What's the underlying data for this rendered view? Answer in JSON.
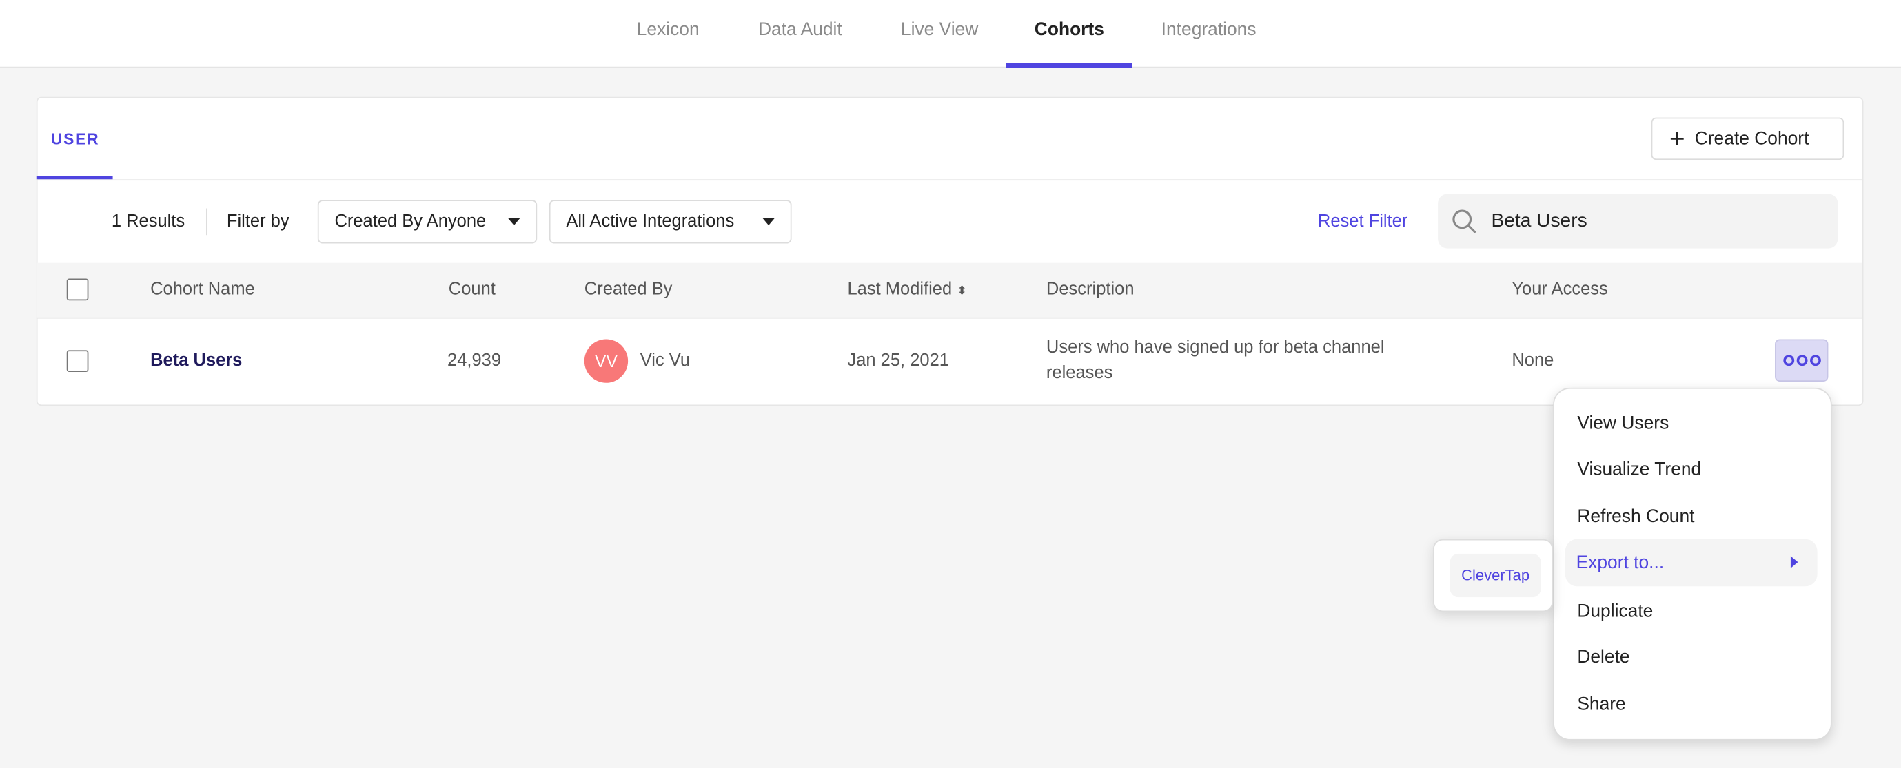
{
  "nav": {
    "tabs": [
      {
        "label": "Lexicon"
      },
      {
        "label": "Data Audit"
      },
      {
        "label": "Live View"
      },
      {
        "label": "Cohorts",
        "active": true
      },
      {
        "label": "Integrations"
      }
    ]
  },
  "section_tab": "USER",
  "create_button": "Create Cohort",
  "filters": {
    "results": "1 Results",
    "filter_by": "Filter by",
    "created_by": "Created By Anyone",
    "integrations": "All Active Integrations",
    "reset": "Reset Filter",
    "search_value": "Beta Users"
  },
  "table": {
    "headers": [
      "Cohort Name",
      "Count",
      "Created By",
      "Last Modified",
      "Description",
      "Your Access"
    ],
    "rows": [
      {
        "name": "Beta Users",
        "count": "24,939",
        "avatar_initials": "VV",
        "creator": "Vic Vu",
        "modified": "Jan 25, 2021",
        "description_line1": "Users who have signed up for beta channel",
        "description_line2": "releases",
        "access": "None"
      }
    ]
  },
  "menu": {
    "items": [
      "View Users",
      "Visualize Trend",
      "Refresh Count",
      "Export to...",
      "Duplicate",
      "Delete",
      "Share"
    ],
    "submenu": [
      "CleverTap"
    ]
  },
  "colors": {
    "accent": "#4f44e0",
    "avatar": "#f87878",
    "name_link": "#1f1a5c"
  }
}
